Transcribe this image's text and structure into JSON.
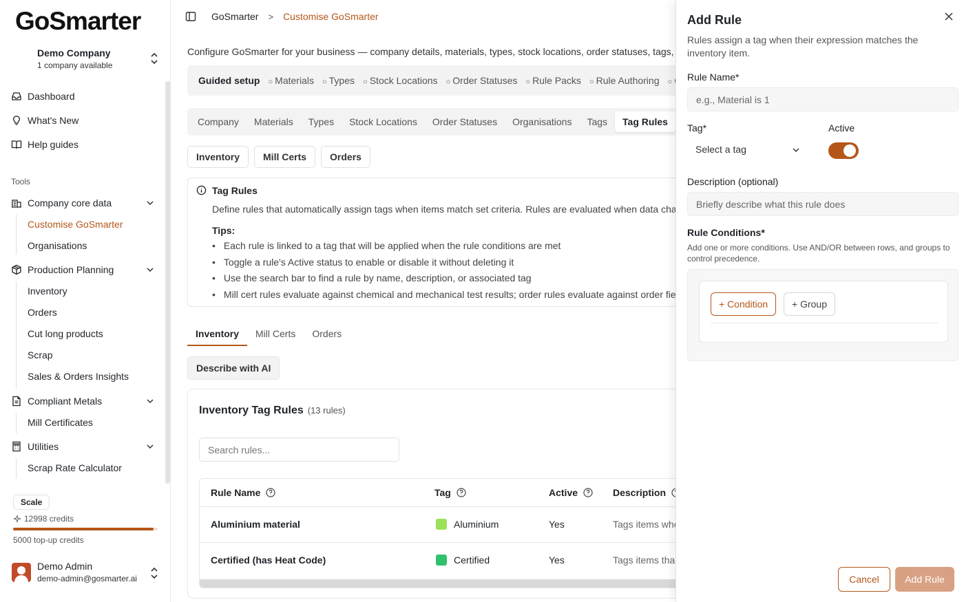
{
  "brand": {
    "logo_text": "GoSmarter",
    "accent": "#b5561a"
  },
  "company": {
    "name": "Demo Company",
    "sub": "1 company available"
  },
  "nav": {
    "dashboard": "Dashboard",
    "whats_new": "What's New",
    "help": "Help guides"
  },
  "tools_label": "Tools",
  "groups": {
    "company_core": {
      "label": "Company core data",
      "items": [
        "Customise GoSmarter",
        "Organisations"
      ]
    },
    "production": {
      "label": "Production Planning",
      "items": [
        "Inventory",
        "Orders",
        "Cut long products",
        "Scrap",
        "Sales & Orders Insights"
      ]
    },
    "compliant": {
      "label": "Compliant Metals",
      "items": [
        "Mill Certificates"
      ]
    },
    "utilities": {
      "label": "Utilities",
      "items": [
        "Scrap Rate Calculator"
      ]
    }
  },
  "plan": {
    "name": "Scale",
    "credits": "12998 credits",
    "topup": "5000 top-up credits",
    "credit_level": 0.97
  },
  "user": {
    "name": "Demo Admin",
    "email": "demo-admin@gosmarter.ai"
  },
  "breadcrumb": {
    "root": "GoSmarter",
    "current": "Customise GoSmarter"
  },
  "intro": "Configure GoSmarter for your business — company details, materials, types, stock locations, order statuses, tags, and",
  "guided": {
    "title": "Guided setup",
    "steps": [
      "Materials",
      "Types",
      "Stock Locations",
      "Order Statuses",
      "Rule Packs",
      "Rule Authoring",
      "O"
    ]
  },
  "tabs_primary": [
    "Company",
    "Materials",
    "Types",
    "Stock Locations",
    "Order Statuses",
    "Organisations",
    "Tags",
    "Tag Rules"
  ],
  "tabs_secondary": [
    "Inventory",
    "Mill Certs",
    "Orders"
  ],
  "info": {
    "title": "Tag Rules",
    "desc": "Define rules that automatically assign tags when items match set criteria. Rules are evaluated when data chang",
    "tips_label": "Tips:",
    "tips": [
      "Each rule is linked to a tag that will be applied when the rule conditions are met",
      "Toggle a rule's Active status to enable or disable it without deleting it",
      "Use the search bar to find a rule by name, description, or associated tag",
      "Mill cert rules evaluate against chemical and mechanical test results; order rules evaluate against order fields"
    ]
  },
  "tabs_underline": [
    "Inventory",
    "Mill Certs",
    "Orders"
  ],
  "ai_button": "Describe with AI",
  "rules_card": {
    "title": "Inventory Tag Rules",
    "count": "(13 rules)",
    "search_placeholder": "Search rules...",
    "columns": [
      "Rule Name",
      "Tag",
      "Active",
      "Description"
    ],
    "rows": [
      {
        "name": "Aluminium material",
        "tag": "Aluminium",
        "tag_color": "#9be25a",
        "active": "Yes",
        "desc": "Tags items whe"
      },
      {
        "name": "Certified (has Heat Code)",
        "tag": "Certified",
        "tag_color": "#2fc26a",
        "active": "Yes",
        "desc": "Tags items tha"
      }
    ]
  },
  "drawer": {
    "title": "Add Rule",
    "desc": "Rules assign a tag when their expression matches the inventory item.",
    "rule_name_label": "Rule Name*",
    "rule_name_placeholder": "e.g., Material is 1",
    "tag_label": "Tag*",
    "tag_placeholder": "Select a tag",
    "active_label": "Active",
    "desc_label": "Description (optional)",
    "desc_placeholder": "Briefly describe what this rule does",
    "conditions_label": "Rule Conditions*",
    "conditions_hint": "Add one or more conditions. Use AND/OR between rows, and groups to control precedence.",
    "add_condition": "+ Condition",
    "add_group": "+ Group",
    "cancel": "Cancel",
    "submit": "Add Rule"
  }
}
